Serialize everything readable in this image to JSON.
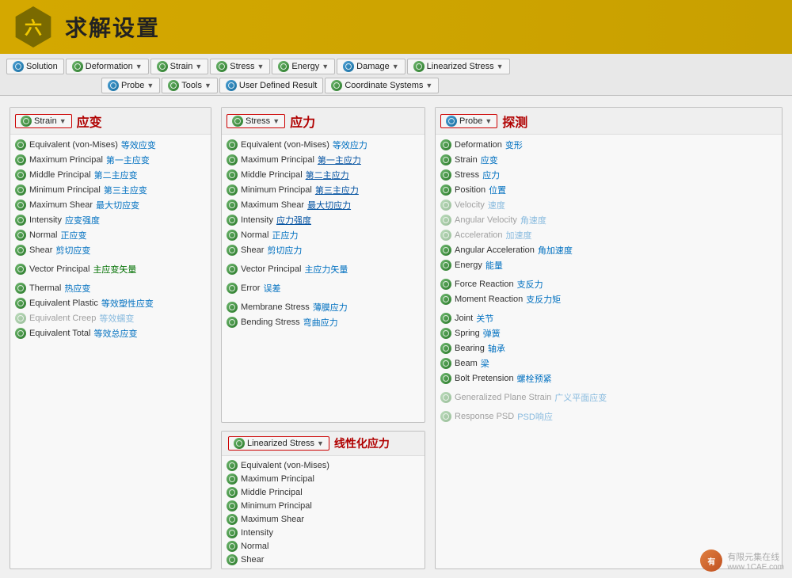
{
  "header": {
    "hex_label": "六",
    "title": "求解设置"
  },
  "toolbar": {
    "row1": [
      {
        "id": "solution",
        "label": "Solution",
        "has_icon": true,
        "has_arrow": false
      },
      {
        "id": "deformation",
        "label": "Deformation",
        "has_icon": true,
        "has_arrow": true
      },
      {
        "id": "strain",
        "label": "Strain",
        "has_icon": true,
        "has_arrow": true
      },
      {
        "id": "stress",
        "label": "Stress",
        "has_icon": true,
        "has_arrow": true
      },
      {
        "id": "energy",
        "label": "Energy",
        "has_icon": true,
        "has_arrow": true
      },
      {
        "id": "damage",
        "label": "Damage",
        "has_icon": true,
        "has_arrow": true
      },
      {
        "id": "linearized_stress",
        "label": "Linearized Stress",
        "has_icon": true,
        "has_arrow": true
      }
    ],
    "row2": [
      {
        "id": "probe",
        "label": "Probe",
        "has_icon": true,
        "has_arrow": true
      },
      {
        "id": "tools",
        "label": "Tools",
        "has_icon": true,
        "has_arrow": true
      },
      {
        "id": "user_defined",
        "label": "User Defined Result",
        "has_icon": true,
        "has_arrow": false
      },
      {
        "id": "coordinate",
        "label": "Coordinate Systems",
        "has_icon": true,
        "has_arrow": true
      }
    ]
  },
  "strain_panel": {
    "btn_label": "Strain",
    "title_cn": "应变",
    "items": [
      {
        "en": "Equivalent (von-Mises)",
        "cn": "等效应变",
        "disabled": false
      },
      {
        "en": "Maximum Principal",
        "cn": "第一主应变",
        "disabled": false
      },
      {
        "en": "Middle Principal",
        "cn": "第二主应变",
        "disabled": false
      },
      {
        "en": "Minimum Principal",
        "cn": "第三主应变",
        "disabled": false
      },
      {
        "en": "Maximum Shear",
        "cn": "最大切应变",
        "disabled": false
      },
      {
        "en": "Intensity",
        "cn": "应变强度",
        "disabled": false
      },
      {
        "en": "Normal",
        "cn": "正应变",
        "disabled": false
      },
      {
        "en": "Shear",
        "cn": "剪切应变",
        "disabled": false
      },
      {
        "sep": true
      },
      {
        "en": "Vector Principal",
        "cn": "主应变矢量",
        "cn_green": true,
        "disabled": false
      },
      {
        "sep": true
      },
      {
        "en": "Thermal",
        "cn": "热应变",
        "disabled": false
      },
      {
        "en": "Equivalent Plastic",
        "cn": "等效塑性应变",
        "disabled": false
      },
      {
        "en": "Equivalent Creep",
        "cn": "等效蠕变",
        "disabled": true
      },
      {
        "en": "Equivalent Total",
        "cn": "等效总应变",
        "disabled": false
      }
    ]
  },
  "stress_panel": {
    "btn_label": "Stress",
    "title_cn": "应力",
    "items": [
      {
        "en": "Equivalent (von-Mises)",
        "cn": "等效应力",
        "disabled": false
      },
      {
        "en": "Maximum Principal",
        "cn": "第一主应力",
        "cn_blue_link": true,
        "disabled": false
      },
      {
        "en": "Middle Principal",
        "cn": "第二主应力",
        "cn_blue_link": true,
        "disabled": false
      },
      {
        "en": "Minimum Principal",
        "cn": "第三主应力",
        "cn_blue_link": true,
        "disabled": false
      },
      {
        "en": "Maximum Shear",
        "cn": "最大切应力",
        "cn_blue_link": true,
        "disabled": false
      },
      {
        "en": "Intensity",
        "cn": "应力强度",
        "cn_blue_link": true,
        "disabled": false
      },
      {
        "en": "Normal",
        "cn": "正应力",
        "disabled": false
      },
      {
        "en": "Shear",
        "cn": "剪切应力",
        "disabled": false
      },
      {
        "sep": true
      },
      {
        "en": "Vector Principal",
        "cn": "主应力矢量",
        "disabled": false
      },
      {
        "sep": true
      },
      {
        "en": "Error",
        "cn": "误差",
        "disabled": false
      },
      {
        "sep": true
      },
      {
        "en": "Membrane Stress",
        "cn": "薄膜应力",
        "disabled": false
      },
      {
        "en": "Bending Stress",
        "cn": "弯曲应力",
        "disabled": false
      }
    ]
  },
  "probe_panel": {
    "btn_label": "Probe",
    "title_cn": "探测",
    "items": [
      {
        "en": "Deformation",
        "cn": "变形",
        "disabled": false
      },
      {
        "en": "Strain",
        "cn": "应变",
        "disabled": false
      },
      {
        "en": "Stress",
        "cn": "应力",
        "disabled": false
      },
      {
        "en": "Position",
        "cn": "位置",
        "disabled": false
      },
      {
        "en": "Velocity",
        "cn": "速度",
        "disabled": true
      },
      {
        "en": "Angular Velocity",
        "cn": "角速度",
        "disabled": true
      },
      {
        "en": "Acceleration",
        "cn": "加速度",
        "disabled": true
      },
      {
        "en": "Angular Acceleration",
        "cn": "角加速度",
        "disabled": false
      },
      {
        "en": "Energy",
        "cn": "能量",
        "disabled": false
      },
      {
        "sep": true
      },
      {
        "en": "Force Reaction",
        "cn": "支反力",
        "disabled": false
      },
      {
        "en": "Moment Reaction",
        "cn": "支反力矩",
        "disabled": false
      },
      {
        "sep": true
      },
      {
        "en": "Joint",
        "cn": "关节",
        "disabled": false
      },
      {
        "en": "Spring",
        "cn": "弹簧",
        "disabled": false
      },
      {
        "en": "Bearing",
        "cn": "轴承",
        "disabled": false
      },
      {
        "en": "Beam",
        "cn": "梁",
        "disabled": false
      },
      {
        "en": "Bolt Pretension",
        "cn": "螺栓预紧",
        "disabled": false
      },
      {
        "sep": true
      },
      {
        "en": "Generalized Plane Strain",
        "cn": "广义平面应变",
        "disabled": true
      },
      {
        "sep": true
      },
      {
        "en": "Response PSD",
        "cn": "PSD响应",
        "disabled": true
      }
    ]
  },
  "linearized_panel": {
    "btn_label": "Linearized Stress",
    "title_cn": "线性化应力",
    "items": [
      {
        "en": "Equivalent (von-Mises)",
        "disabled": false
      },
      {
        "en": "Maximum Principal",
        "disabled": false
      },
      {
        "en": "Middle Principal",
        "disabled": false
      },
      {
        "en": "Minimum Principal",
        "disabled": false
      },
      {
        "en": "Maximum Shear",
        "disabled": false
      },
      {
        "en": "Intensity",
        "disabled": false
      },
      {
        "en": "Normal",
        "disabled": false
      },
      {
        "en": "Shear",
        "disabled": false
      }
    ]
  },
  "watermark": {
    "logo": "有",
    "text1": "有限元集在线",
    "text2": "www.1CAE.com"
  }
}
